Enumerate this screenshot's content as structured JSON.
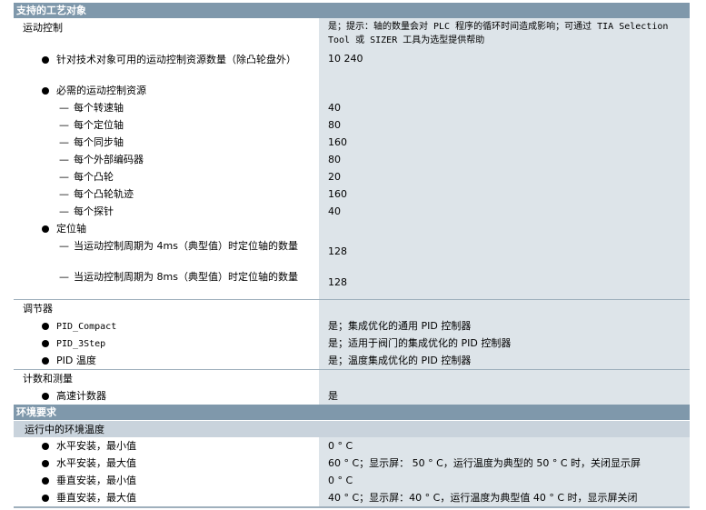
{
  "sections": {
    "process_objects": {
      "title": "支持的工艺对象",
      "motion": {
        "label": "运动控制",
        "value": "是；提示：轴的数量会对 PLC 程序的循环时间造成影响；可通过 TIA Selection Tool 或 SIZER 工具为选型提供帮助",
        "rows": [
          {
            "label": "针对技术对象可用的运动控制资源数量（除凸轮盘外）",
            "value": "10 240"
          },
          {
            "label": "必需的运动控制资源",
            "value": ""
          },
          {
            "label": "每个转速轴",
            "value": "40"
          },
          {
            "label": "每个定位轴",
            "value": "80"
          },
          {
            "label": "每个同步轴",
            "value": "160"
          },
          {
            "label": "每个外部编码器",
            "value": "80"
          },
          {
            "label": "每个凸轮",
            "value": "20"
          },
          {
            "label": "每个凸轮轨迹",
            "value": "160"
          },
          {
            "label": "每个探针",
            "value": "40"
          },
          {
            "label": "定位轴",
            "value": ""
          },
          {
            "label": "当运动控制周期为 4ms（典型值）时定位轴的数量",
            "value": "128"
          },
          {
            "label": "当运动控制周期为 8ms（典型值）时定位轴的数量",
            "value": "128"
          }
        ]
      },
      "controller": {
        "label": "调节器",
        "rows": [
          {
            "label": "PID_Compact",
            "value": "是；集成优化的通用 PID 控制器"
          },
          {
            "label": "PID_3Step",
            "value": "是；适用于阀门的集成优化的 PID 控制器"
          },
          {
            "label": "PID 温度",
            "value": "是；温度集成优化的 PID 控制器"
          }
        ]
      },
      "counting": {
        "label": "计数和测量",
        "rows": [
          {
            "label": "高速计数器",
            "value": "是"
          }
        ]
      }
    },
    "environment": {
      "title": "环境要求",
      "sub_title": "运行中的环境温度",
      "rows": [
        {
          "label": "水平安装，最小值",
          "value": "0 ° C"
        },
        {
          "label": "水平安装，最大值",
          "value": "60 ° C；显示屏： 50 ° C，运行温度为典型的 50 ° C 时，关闭显示屏"
        },
        {
          "label": "垂直安装，最小值",
          "value": "0 ° C"
        },
        {
          "label": "垂直安装，最大值",
          "value": "40 ° C；显示屏：40 ° C，运行温度为典型值 40 ° C 时，显示屏关闭"
        }
      ]
    }
  },
  "colors": {
    "section_header": "#7f98ab",
    "sub_header": "#c9d3dc",
    "value_column": "#dde4e9"
  }
}
